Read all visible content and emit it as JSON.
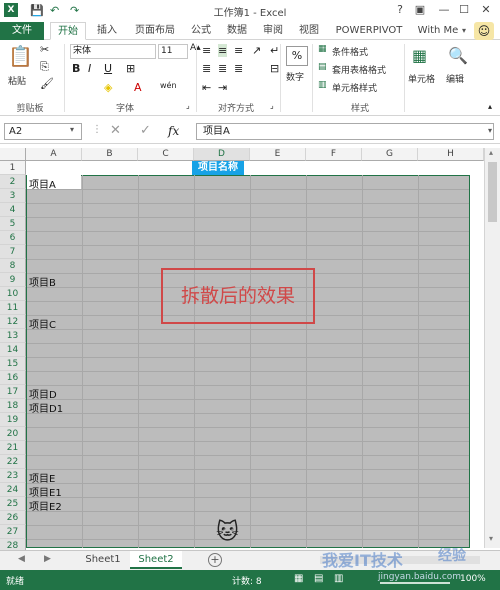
{
  "window": {
    "title": "工作簿1 - Excel",
    "help": "?",
    "restore": "▣",
    "minimize": "—",
    "maximize": "☐",
    "close": "✕"
  },
  "ribbon_tabs": [
    "文件",
    "开始",
    "插入",
    "页面布局",
    "公式",
    "数据",
    "审阅",
    "视图",
    "POWERPIVOT",
    "With Me"
  ],
  "ribbon": {
    "paste": "粘贴",
    "clipboard": "剪贴板",
    "font_name": "宋体",
    "font_size": "11",
    "font_group": "字体",
    "align_group": "对齐方式",
    "number": "数字",
    "number_symbol": "%",
    "cond_format": "条件格式",
    "table_format": "套用表格格式",
    "cell_style": "单元格样式",
    "style_group": "样式",
    "cells": "单元格",
    "editing": "编辑",
    "wen": "wén"
  },
  "formula_bar": {
    "name_box": "A2",
    "fx": "fx",
    "value": "项目A"
  },
  "columns": [
    "A",
    "B",
    "C",
    "D",
    "E",
    "F",
    "G",
    "H"
  ],
  "rows": [
    "1",
    "2",
    "3",
    "4",
    "5",
    "6",
    "7",
    "8",
    "9",
    "10",
    "11",
    "12",
    "13",
    "14",
    "15",
    "16",
    "17",
    "18",
    "19",
    "20",
    "21",
    "22",
    "23",
    "24",
    "25",
    "26",
    "27",
    "28"
  ],
  "cells": {
    "D1": "项目名称",
    "A2": "项目A",
    "A9": "项目B",
    "A12": "项目C",
    "A17": "项目D",
    "A18": "项目D1",
    "A23": "项目E",
    "A24": "项目E1",
    "A25": "项目E2"
  },
  "annotation": "拆散后的效果",
  "sheets": [
    "Sheet1",
    "Sheet2"
  ],
  "add_sheet": "+",
  "status": {
    "ready": "就绪",
    "count": "计数: 8",
    "zoom": "100%"
  },
  "watermark": "我爱IT技术",
  "watermark_url": "jingyan.baidu.com",
  "watermark_brand": "经验",
  "colors": {
    "excel_green": "#217346",
    "header_cell": "#17a2e6",
    "annotation_red": "#d04848",
    "selection_grey": "#bcbcbc"
  }
}
